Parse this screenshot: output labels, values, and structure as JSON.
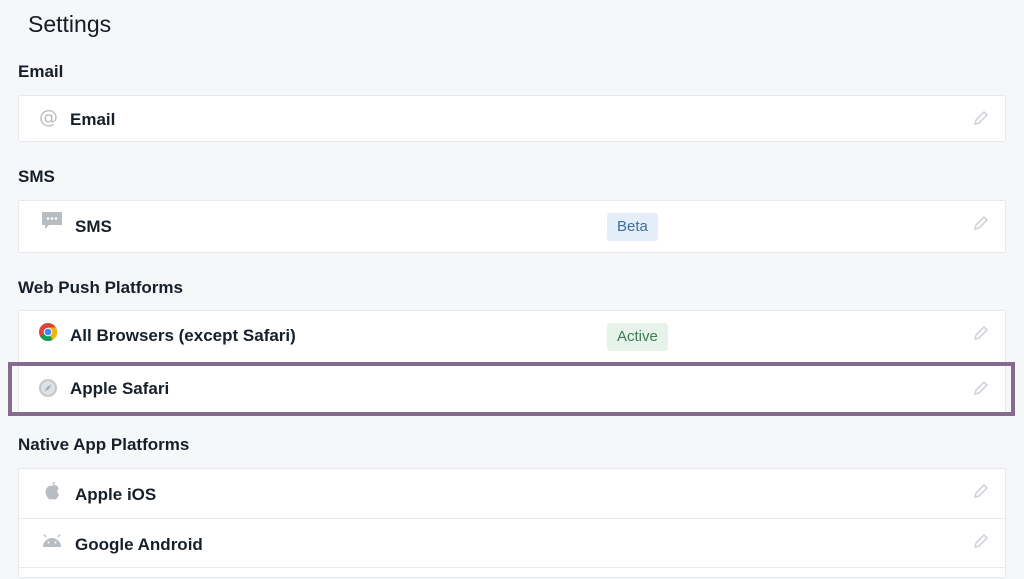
{
  "page": {
    "title": "Settings"
  },
  "sections": [
    {
      "title": "Email",
      "rows": [
        {
          "label": "Email",
          "icon": "at-icon"
        }
      ]
    },
    {
      "title": "SMS",
      "rows": [
        {
          "label": "SMS",
          "icon": "message-icon",
          "badge": "Beta"
        }
      ]
    },
    {
      "title": "Web Push Platforms",
      "rows": [
        {
          "label": "All Browsers (except Safari)",
          "icon": "chrome-icon",
          "badge": "Active"
        },
        {
          "label": "Apple Safari",
          "icon": "compass-icon"
        }
      ]
    },
    {
      "title": "Native App Platforms",
      "rows": [
        {
          "label": "Apple iOS",
          "icon": "apple-icon"
        },
        {
          "label": "Google Android",
          "icon": "android-icon"
        }
      ]
    }
  ],
  "colors": {
    "highlight_border": "#866b8e",
    "badge_beta_bg": "#e3eef8",
    "badge_active_bg": "#e6f3ea"
  }
}
